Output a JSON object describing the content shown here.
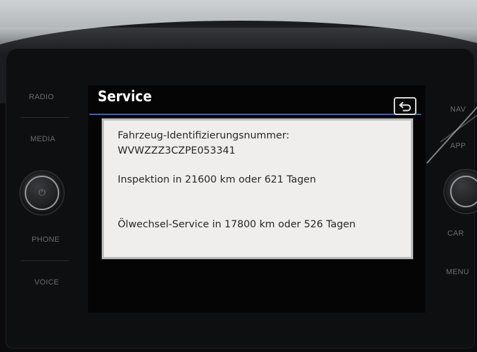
{
  "left_buttons": [
    {
      "label": "RADIO"
    },
    {
      "label": "MEDIA"
    },
    {
      "label": "PHONE"
    },
    {
      "label": "VOICE"
    }
  ],
  "right_buttons": [
    {
      "label": "NAV"
    },
    {
      "label": "APP"
    },
    {
      "label": "CAR"
    },
    {
      "label": "MENU"
    }
  ],
  "screen": {
    "title": "Service",
    "back_icon": "back-arrow-icon",
    "lines": [
      "Fahrzeug-Identifizierungsnummer:",
      "WVWZZZ3CZPE053341",
      "Inspektion in 21600 km oder 621 Tagen",
      "Ölwechsel-Service in 17800 km oder 526 Tagen"
    ]
  },
  "colors": {
    "accent_line": "#3a63c8",
    "panel_background": "#efeeec",
    "screen_background": "#050506"
  }
}
